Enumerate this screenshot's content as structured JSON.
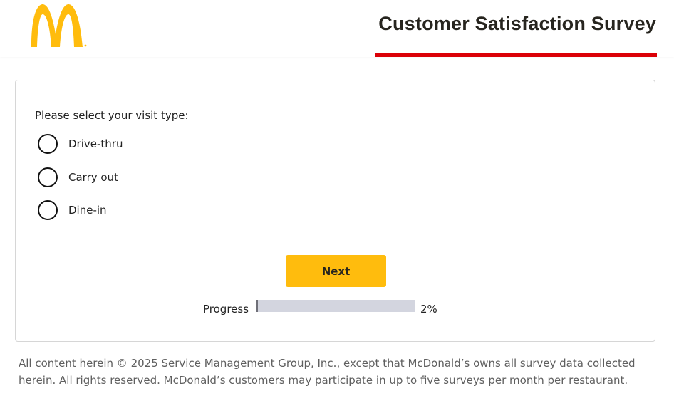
{
  "header": {
    "title": "Customer Satisfaction Survey",
    "logo_icon": "mcdonalds-golden-arches-logo",
    "brand_yellow": "#ffbc0d",
    "accent_red": "#db0007"
  },
  "question": {
    "text": "Please select your visit type:",
    "options": [
      {
        "label": "Drive-thru",
        "selected": false
      },
      {
        "label": "Carry out",
        "selected": false
      },
      {
        "label": "Dine-in",
        "selected": false
      }
    ]
  },
  "actions": {
    "next_label": "Next"
  },
  "progress": {
    "label": "Progress",
    "value_text": "2%",
    "percent": 2
  },
  "footer": {
    "text": "All content herein © 2025 Service Management Group, Inc., except that McDonald’s owns all survey data collected herein. All rights reserved. McDonald’s customers may participate in up to five surveys per month per restaurant."
  }
}
